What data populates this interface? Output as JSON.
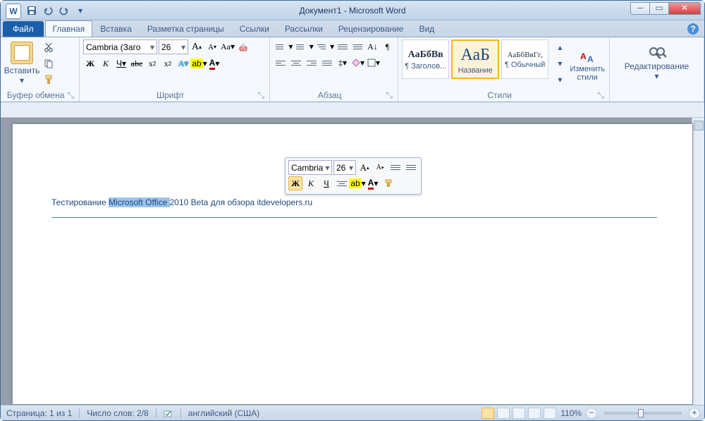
{
  "title": "Документ1 - Microsoft Word",
  "app_icon": "W",
  "tabs": {
    "file": "Файл",
    "home": "Главная",
    "insert": "Вставка",
    "layout": "Разметка страницы",
    "refs": "Ссылки",
    "mail": "Рассылки",
    "review": "Рецензирование",
    "view": "Вид"
  },
  "groups": {
    "clipboard": {
      "label": "Буфер обмена",
      "paste": "Вставить"
    },
    "font": {
      "label": "Шрифт",
      "name": "Cambria (Заго",
      "size": "26",
      "bold": "Ж",
      "italic": "К",
      "underline": "Ч",
      "grow": "A",
      "shrink": "A",
      "case": "Aa",
      "clear": "⌫"
    },
    "para": {
      "label": "Абзац"
    },
    "styles": {
      "label": "Стили",
      "s1_sample": "АаБбВв",
      "s1_name": "¶ Заголов...",
      "s2_sample": "АаБ",
      "s2_name": "Название",
      "s3_sample": "АаБбВвГг,",
      "s3_name": "¶ Обычный",
      "change": "Изменить стили"
    },
    "edit": {
      "label": "Редактирование"
    }
  },
  "mini": {
    "font": "Cambria",
    "size": "26",
    "bold": "Ж",
    "italic": "К",
    "underline": "Ч"
  },
  "doc": {
    "t1": "Тестирование ",
    "sel": "Microsoft Office ",
    "t2": "2010 Beta для обзора itdevelopers.ru"
  },
  "status": {
    "page": "Страница: 1 из 1",
    "words": "Число слов: 2/8",
    "lang": "английский (США)",
    "zoom": "110%"
  }
}
